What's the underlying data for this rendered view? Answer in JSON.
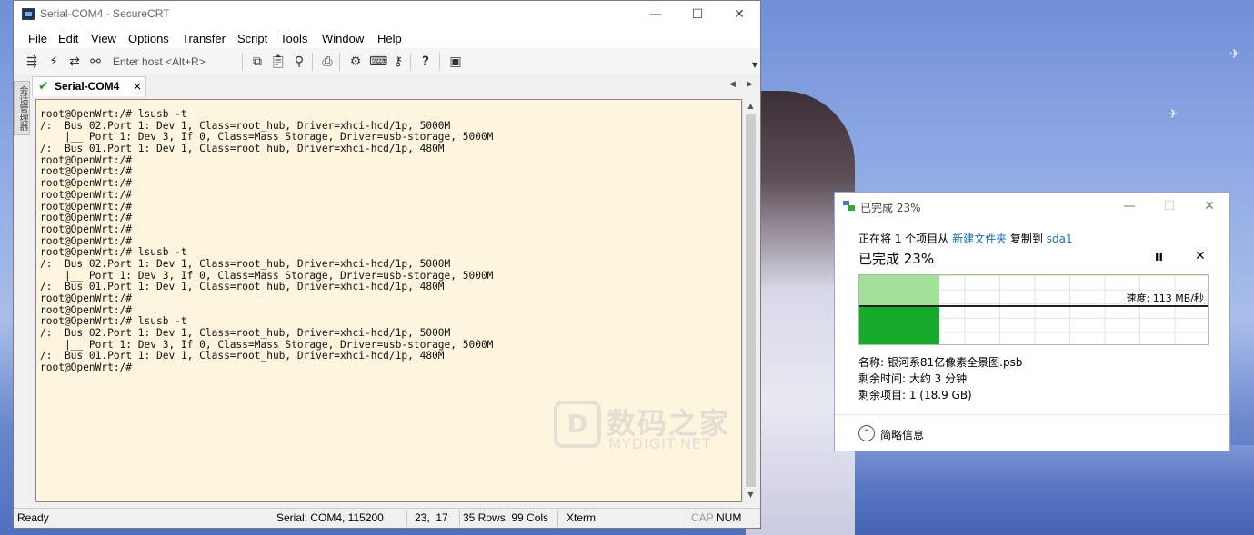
{
  "window": {
    "title": "Serial-COM4 - SecureCRT",
    "minimize": "—",
    "maximize": "☐",
    "close": "✕"
  },
  "menu": [
    "File",
    "Edit",
    "View",
    "Options",
    "Transfer",
    "Script",
    "Tools",
    "Window",
    "Help"
  ],
  "toolbar": {
    "enter_host_placeholder": "Enter host <Alt+R>",
    "icons": [
      "connect-icon",
      "quick-connect-icon",
      "reconnect-icon",
      "disconnect-icon",
      "copy-icon",
      "paste-icon",
      "find-icon",
      "print-icon",
      "settings-icon",
      "keymap-icon",
      "sftp-icon",
      "help-icon",
      "screenshot-icon"
    ]
  },
  "side_panel_label": "会话管理器",
  "tab": {
    "label": "Serial-COM4",
    "close": "×"
  },
  "terminal": {
    "lines": [
      "root@OpenWrt:/# lsusb -t",
      "/:  Bus 02.Port 1: Dev 1, Class=root_hub, Driver=xhci-hcd/1p, 5000M",
      "    |__ Port 1: Dev 3, If 0, Class=Mass Storage, Driver=usb-storage, 5000M",
      "/:  Bus 01.Port 1: Dev 1, Class=root_hub, Driver=xhci-hcd/1p, 480M",
      "root@OpenWrt:/#",
      "root@OpenWrt:/#",
      "root@OpenWrt:/#",
      "root@OpenWrt:/#",
      "root@OpenWrt:/#",
      "root@OpenWrt:/#",
      "root@OpenWrt:/#",
      "root@OpenWrt:/#",
      "root@OpenWrt:/# lsusb -t",
      "/:  Bus 02.Port 1: Dev 1, Class=root_hub, Driver=xhci-hcd/1p, 5000M",
      "    |__ Port 1: Dev 3, If 0, Class=Mass Storage, Driver=usb-storage, 5000M",
      "/:  Bus 01.Port 1: Dev 1, Class=root_hub, Driver=xhci-hcd/1p, 480M",
      "root@OpenWrt:/#",
      "root@OpenWrt:/#",
      "root@OpenWrt:/# lsusb -t",
      "/:  Bus 02.Port 1: Dev 1, Class=root_hub, Driver=xhci-hcd/1p, 5000M",
      "    |__ Port 1: Dev 3, If 0, Class=Mass Storage, Driver=usb-storage, 5000M",
      "/:  Bus 01.Port 1: Dev 1, Class=root_hub, Driver=xhci-hcd/1p, 480M",
      "root@OpenWrt:/#"
    ]
  },
  "statusbar": {
    "ready": "Ready",
    "connection": "Serial: COM4, 115200",
    "cursor": "23,  17",
    "size": "35 Rows, 99 Cols",
    "term_type": "Xterm",
    "cap": "CAP",
    "num": "NUM"
  },
  "watermark": {
    "cn": "数码之家",
    "en": "MYDIGIT.NET",
    "logo": "D"
  },
  "copy_dialog": {
    "title": "已完成 23%",
    "line_prefix": "正在将 1 个项目从 ",
    "source": "新建文件夹",
    "line_mid": " 复制到 ",
    "dest": "sda1",
    "percent_label": "已完成 23%",
    "progress_fraction": 0.23,
    "pause": "II",
    "stop": "✕",
    "speed": "速度: 113 MB/秒",
    "name": "名称: 银河系81亿像素全景图.psb",
    "time_left": "剩余时间: 大约 3 分钟",
    "items_left": "剩余项目: 1 (18.9 GB)",
    "more_info": "简略信息",
    "more_icon": "^"
  },
  "colors": {
    "terminal_bg": "#fdf5dd",
    "progress_green": "#16ab2b",
    "progress_light": "#a2e19a",
    "link": "#1a6cc7"
  }
}
